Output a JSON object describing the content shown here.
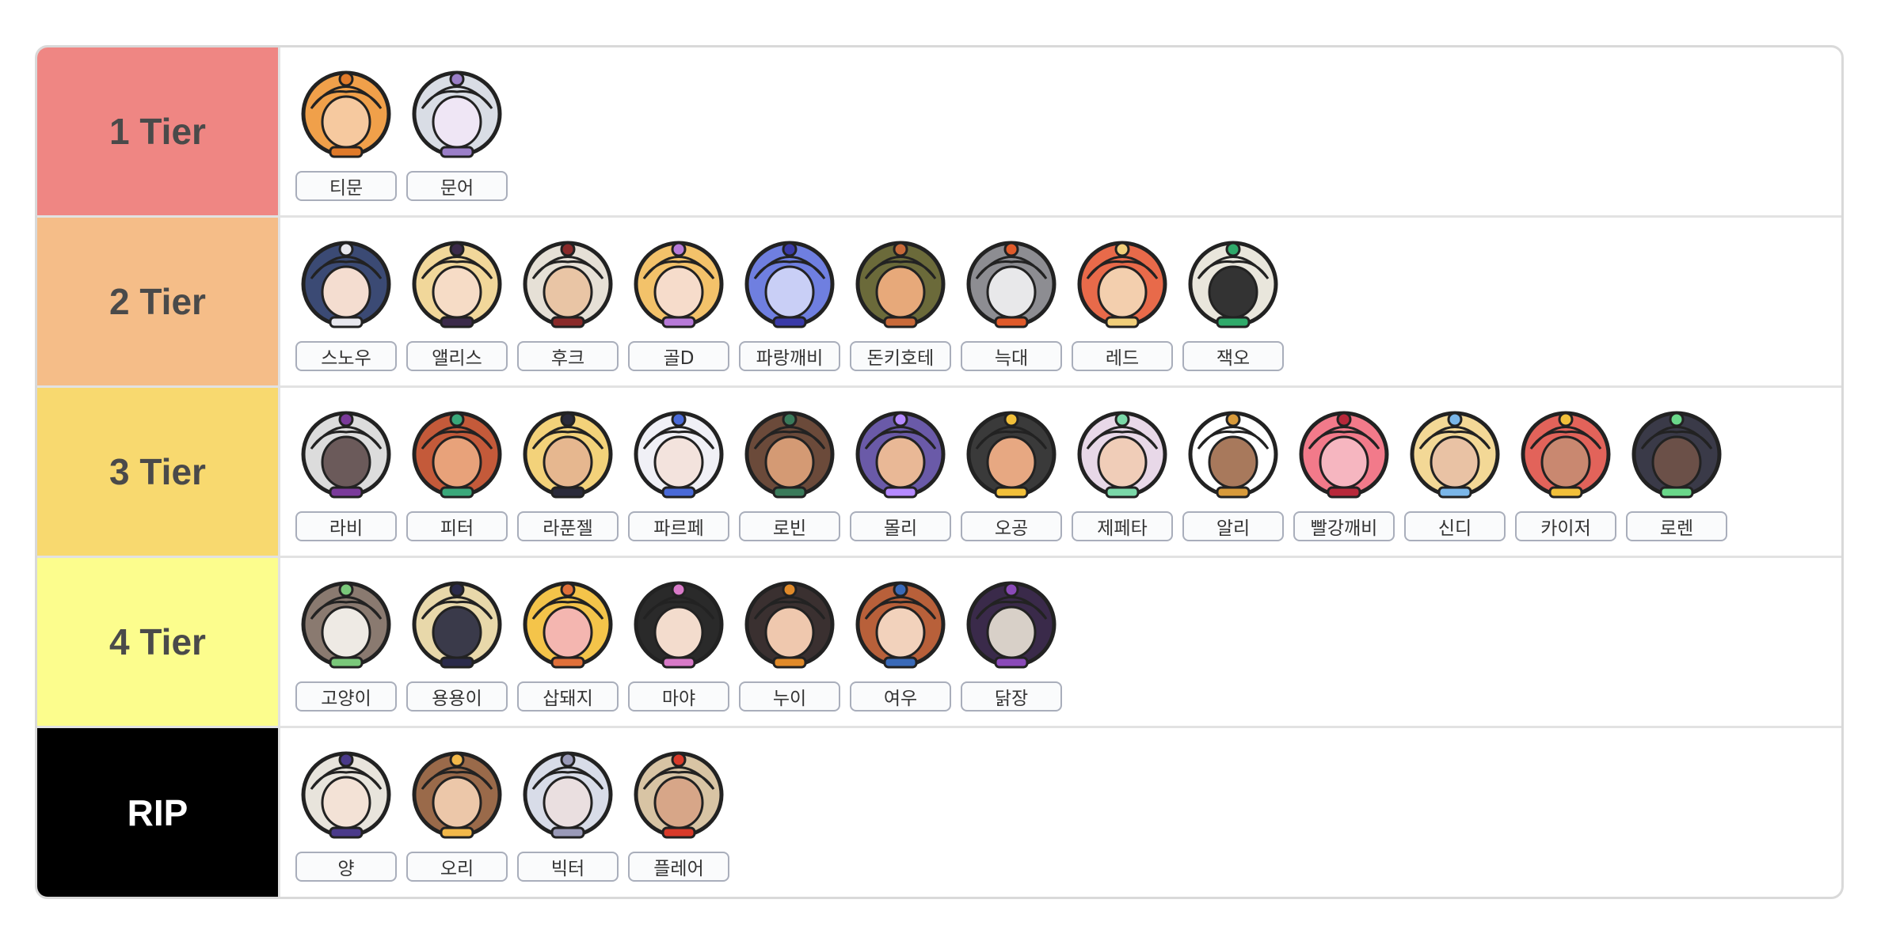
{
  "tiers": [
    {
      "label": "1 Tier",
      "color": "#ef8683",
      "text_color": "#4a4a4a",
      "characters": [
        {
          "name": "티문",
          "hair": "#f0a04a",
          "accent": "#e07a2a",
          "skin": "#f6c99f",
          "icon": "character-avatar"
        },
        {
          "name": "문어",
          "hair": "#d9dde5",
          "accent": "#9b7fc8",
          "skin": "#efe6f5",
          "icon": "character-avatar"
        }
      ]
    },
    {
      "label": "2 Tier",
      "color": "#f5bd88",
      "text_color": "#4a4a4a",
      "characters": [
        {
          "name": "스노우",
          "hair": "#3b4a74",
          "accent": "#e8e8ee",
          "skin": "#f4ddd0",
          "icon": "character-avatar"
        },
        {
          "name": "앨리스",
          "hair": "#f1d79a",
          "accent": "#3b2a4a",
          "skin": "#f6dcc6",
          "icon": "character-avatar"
        },
        {
          "name": "후크",
          "hair": "#e6e0d6",
          "accent": "#8a2a2a",
          "skin": "#e9c5a5",
          "icon": "character-avatar"
        },
        {
          "name": "골D",
          "hair": "#f3c26a",
          "accent": "#b77ad8",
          "skin": "#f6dccb",
          "icon": "character-avatar"
        },
        {
          "name": "파랑깨비",
          "hair": "#6f7fe0",
          "accent": "#3a3aa8",
          "skin": "#c9cff6",
          "icon": "character-avatar"
        },
        {
          "name": "돈키호테",
          "hair": "#6b6a3a",
          "accent": "#c96a3a",
          "skin": "#e7a97a",
          "icon": "character-avatar"
        },
        {
          "name": "늑대",
          "hair": "#8d8d92",
          "accent": "#e05a2a",
          "skin": "#e8e8ea",
          "icon": "character-avatar"
        },
        {
          "name": "레드",
          "hair": "#e86a4a",
          "accent": "#f1cf7a",
          "skin": "#f3cfae",
          "icon": "character-avatar"
        },
        {
          "name": "잭오",
          "hair": "#e9e6dc",
          "accent": "#2faa6a",
          "skin": "#333333",
          "icon": "character-avatar"
        }
      ]
    },
    {
      "label": "3 Tier",
      "color": "#f8d96f",
      "text_color": "#4a4a4a",
      "characters": [
        {
          "name": "라비",
          "hair": "#dcdcdc",
          "accent": "#7a3a9a",
          "skin": "#6b5a5a",
          "icon": "character-avatar"
        },
        {
          "name": "피터",
          "hair": "#c45a3a",
          "accent": "#3aa87a",
          "skin": "#e8a27a",
          "icon": "character-avatar"
        },
        {
          "name": "라푼젤",
          "hair": "#f3d27a",
          "accent": "#2a2a3a",
          "skin": "#e6b78f",
          "icon": "character-avatar"
        },
        {
          "name": "파르페",
          "hair": "#f0f0f6",
          "accent": "#4a6ad8",
          "skin": "#f3e3dd",
          "icon": "character-avatar"
        },
        {
          "name": "로빈",
          "hair": "#6b4a3a",
          "accent": "#3a7a5a",
          "skin": "#d49a74",
          "icon": "character-avatar"
        },
        {
          "name": "몰리",
          "hair": "#6a5aa8",
          "accent": "#b58aff",
          "skin": "#e9b896",
          "icon": "character-avatar"
        },
        {
          "name": "오공",
          "hair": "#3a3a3a",
          "accent": "#f2c03a",
          "skin": "#e7a882",
          "icon": "character-avatar"
        },
        {
          "name": "제페타",
          "hair": "#e8d8e8",
          "accent": "#7ad8a8",
          "skin": "#f0cdb8",
          "icon": "character-avatar"
        },
        {
          "name": "알리",
          "hair": "#ffffff",
          "accent": "#d89a3a",
          "skin": "#a8795c",
          "icon": "character-avatar"
        },
        {
          "name": "빨강깨비",
          "hair": "#f27a8a",
          "accent": "#b8283a",
          "skin": "#f6b6c0",
          "icon": "character-avatar"
        },
        {
          "name": "신디",
          "hair": "#f3d896",
          "accent": "#7ab6e8",
          "skin": "#e9c2a4",
          "icon": "character-avatar"
        },
        {
          "name": "카이저",
          "hair": "#e2635a",
          "accent": "#f2c03a",
          "skin": "#c98870",
          "icon": "character-avatar"
        },
        {
          "name": "로렌",
          "hair": "#3a3a48",
          "accent": "#6ad88a",
          "skin": "#6b5048",
          "icon": "character-avatar"
        }
      ]
    },
    {
      "label": "4 Tier",
      "color": "#fcfd8d",
      "text_color": "#4a4a4a",
      "characters": [
        {
          "name": "고양이",
          "hair": "#8a7a70",
          "accent": "#7ac87a",
          "skin": "#eeeae4",
          "icon": "character-avatar"
        },
        {
          "name": "용용이",
          "hair": "#e8d8aa",
          "accent": "#2a2a4a",
          "skin": "#3a3a4a",
          "icon": "character-avatar"
        },
        {
          "name": "삽돼지",
          "hair": "#f4c44a",
          "accent": "#e0703a",
          "skin": "#f4b6b0",
          "icon": "character-avatar"
        },
        {
          "name": "마야",
          "hair": "#2a2a2a",
          "accent": "#d87ac8",
          "skin": "#f3dccd",
          "icon": "character-avatar"
        },
        {
          "name": "누이",
          "hair": "#3a3030",
          "accent": "#e08a2a",
          "skin": "#efc8ae",
          "icon": "character-avatar"
        },
        {
          "name": "여우",
          "hair": "#b8603a",
          "accent": "#3a6ab8",
          "skin": "#f2d2bc",
          "icon": "character-avatar"
        },
        {
          "name": "닭장",
          "hair": "#3a2a4a",
          "accent": "#8a4ab8",
          "skin": "#d8d0c8",
          "icon": "character-avatar"
        }
      ]
    },
    {
      "label": "RIP",
      "color": "#000000",
      "text_color": "#ffffff",
      "characters": [
        {
          "name": "양",
          "hair": "#e8e4dc",
          "accent": "#4a3a8a",
          "skin": "#f3e2d6",
          "icon": "character-avatar"
        },
        {
          "name": "오리",
          "hair": "#9a6a4a",
          "accent": "#f2b84a",
          "skin": "#ecc7a9",
          "icon": "character-avatar"
        },
        {
          "name": "빅터",
          "hair": "#d8dce8",
          "accent": "#9a9ab8",
          "skin": "#eadfe0",
          "icon": "character-avatar"
        },
        {
          "name": "플레어",
          "hair": "#d8c4a4",
          "accent": "#d83a2a",
          "skin": "#d7a688",
          "icon": "character-avatar"
        }
      ]
    }
  ]
}
